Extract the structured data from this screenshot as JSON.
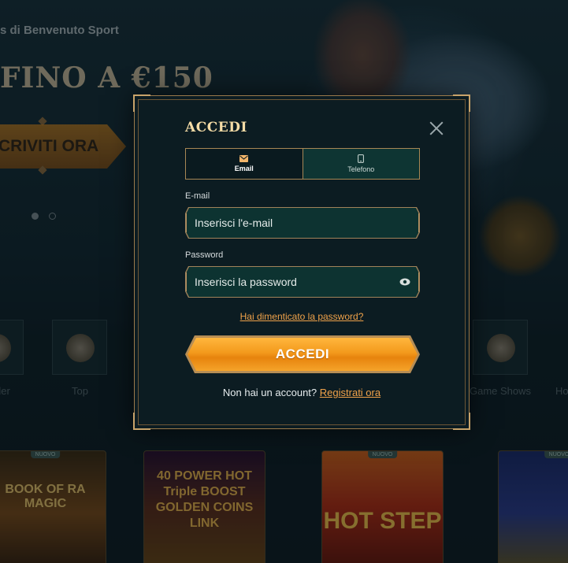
{
  "background": {
    "hero": {
      "subtitle": "s di Benvenuto Sport",
      "title": "FINO A €150",
      "cta_label": "CRIVITI ORA"
    },
    "carousel": {
      "dot_count": 2,
      "active_index": 0
    },
    "categories": [
      {
        "label": "der",
        "icon": "slot-icon"
      },
      {
        "label": "Top",
        "icon": "crown-icon"
      },
      {
        "label": "Game Shows",
        "icon": "wheel-icon"
      },
      {
        "label": "Ho",
        "icon": "category-icon"
      }
    ],
    "games": [
      {
        "badge": "nuovo",
        "title": "BOOK OF RA MAGIC"
      },
      {
        "badge": "",
        "title": "40 POWER HOT Triple BOOST GOLDEN COINS LINK"
      },
      {
        "badge": "nuovo",
        "title": "HOT STEP"
      },
      {
        "badge": "nuovo",
        "title": ""
      }
    ]
  },
  "modal": {
    "title": "ACCEDI",
    "tabs": [
      {
        "label": "Email",
        "icon": "envelope-icon",
        "active": true
      },
      {
        "label": "Telefono",
        "icon": "phone-icon",
        "active": false
      }
    ],
    "email_label": "E-mail",
    "email_placeholder": "Inserisci l'e-mail",
    "email_value": "",
    "password_label": "Password",
    "password_placeholder": "Inserisci la password",
    "password_value": "",
    "forgot_link": "Hai dimenticato la password?",
    "submit_label": "ACCEDI",
    "register_prompt": "Non hai un account?",
    "register_link": "Registrati ora"
  },
  "colors": {
    "accent_orange": "#f39a1c",
    "link_orange": "#f0a24a",
    "gold_border": "#a78755",
    "input_bg": "#0d3331",
    "modal_bg": "#0c1c22"
  }
}
